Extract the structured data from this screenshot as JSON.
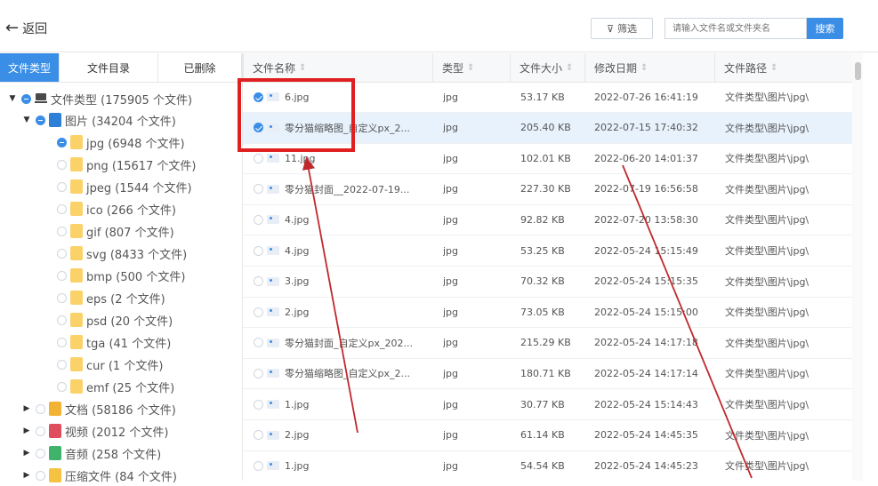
{
  "toolbar": {
    "back_label": "返回",
    "filter_label": "筛选",
    "search_placeholder": "请输入文件名或文件夹名",
    "search_button": "搜索"
  },
  "tabs": [
    {
      "label": "文件类型",
      "active": true
    },
    {
      "label": "文件目录",
      "active": false
    },
    {
      "label": "已删除",
      "active": false
    }
  ],
  "tree": [
    {
      "label": "文件类型 (175905 个文件)",
      "icon": "computer-icon",
      "expanded": true,
      "checked": true
    },
    {
      "label": "图片 (34204 个文件)",
      "icon": "image-folder-icon",
      "expanded": true,
      "checked": true
    },
    {
      "label": "jpg (6948 个文件)",
      "icon": "folder-icon",
      "checked": true
    },
    {
      "label": "png (15617 个文件)",
      "icon": "folder-icon",
      "checked": false
    },
    {
      "label": "jpeg (1544 个文件)",
      "icon": "folder-icon",
      "checked": false
    },
    {
      "label": "ico (266 个文件)",
      "icon": "folder-icon",
      "checked": false
    },
    {
      "label": "gif (807 个文件)",
      "icon": "folder-icon",
      "checked": false
    },
    {
      "label": "svg (8433 个文件)",
      "icon": "folder-icon",
      "checked": false
    },
    {
      "label": "bmp (500 个文件)",
      "icon": "folder-icon",
      "checked": false
    },
    {
      "label": "eps (2 个文件)",
      "icon": "folder-icon",
      "checked": false
    },
    {
      "label": "psd (20 个文件)",
      "icon": "folder-icon",
      "checked": false
    },
    {
      "label": "tga (41 个文件)",
      "icon": "folder-icon",
      "checked": false
    },
    {
      "label": "cur (1 个文件)",
      "icon": "folder-icon",
      "checked": false
    },
    {
      "label": "emf (25 个文件)",
      "icon": "folder-icon",
      "checked": false
    },
    {
      "label": "文档 (58186 个文件)",
      "icon": "document-folder-icon",
      "expanded": false,
      "checked": false
    },
    {
      "label": "视频 (2012 个文件)",
      "icon": "video-folder-icon",
      "expanded": false,
      "checked": false
    },
    {
      "label": "音频 (258 个文件)",
      "icon": "audio-folder-icon",
      "expanded": false,
      "checked": false
    },
    {
      "label": "压缩文件 (84 个文件)",
      "icon": "archive-folder-icon",
      "expanded": false,
      "checked": false
    }
  ],
  "columns": [
    "文件名称",
    "类型",
    "文件大小",
    "修改日期",
    "文件路径"
  ],
  "rows": [
    {
      "name": "6.jpg",
      "type": "jpg",
      "size": "53.17 KB",
      "date": "2022-07-26 16:41:19",
      "path": "文件类型\\图片\\jpg\\",
      "checked": true,
      "selected": false
    },
    {
      "name": "零分猫缩略图_自定义px_2...",
      "type": "jpg",
      "size": "205.40 KB",
      "date": "2022-07-15 17:40:32",
      "path": "文件类型\\图片\\jpg\\",
      "checked": true,
      "selected": true
    },
    {
      "name": "11.jpg",
      "type": "jpg",
      "size": "102.01 KB",
      "date": "2022-06-20 14:01:37",
      "path": "文件类型\\图片\\jpg\\",
      "checked": false,
      "selected": false
    },
    {
      "name": "零分猫封面__2022-07-19...",
      "type": "jpg",
      "size": "227.30 KB",
      "date": "2022-07-19 16:56:58",
      "path": "文件类型\\图片\\jpg\\",
      "checked": false,
      "selected": false
    },
    {
      "name": "4.jpg",
      "type": "jpg",
      "size": "92.82 KB",
      "date": "2022-07-20 13:58:30",
      "path": "文件类型\\图片\\jpg\\",
      "checked": false,
      "selected": false
    },
    {
      "name": "4.jpg",
      "type": "jpg",
      "size": "53.25 KB",
      "date": "2022-05-24 15:15:49",
      "path": "文件类型\\图片\\jpg\\",
      "checked": false,
      "selected": false
    },
    {
      "name": "3.jpg",
      "type": "jpg",
      "size": "70.32 KB",
      "date": "2022-05-24 15:15:35",
      "path": "文件类型\\图片\\jpg\\",
      "checked": false,
      "selected": false
    },
    {
      "name": "2.jpg",
      "type": "jpg",
      "size": "73.05 KB",
      "date": "2022-05-24 15:15:00",
      "path": "文件类型\\图片\\jpg\\",
      "checked": false,
      "selected": false
    },
    {
      "name": "零分猫封面_自定义px_202...",
      "type": "jpg",
      "size": "215.29 KB",
      "date": "2022-05-24 14:17:18",
      "path": "文件类型\\图片\\jpg\\",
      "checked": false,
      "selected": false
    },
    {
      "name": "零分猫缩略图_自定义px_2...",
      "type": "jpg",
      "size": "180.71 KB",
      "date": "2022-05-24 14:17:14",
      "path": "文件类型\\图片\\jpg\\",
      "checked": false,
      "selected": false
    },
    {
      "name": "1.jpg",
      "type": "jpg",
      "size": "30.77 KB",
      "date": "2022-05-24 15:14:43",
      "path": "文件类型\\图片\\jpg\\",
      "checked": false,
      "selected": false
    },
    {
      "name": "2.jpg",
      "type": "jpg",
      "size": "61.14 KB",
      "date": "2022-05-24 14:45:35",
      "path": "文件类型\\图片\\jpg\\",
      "checked": false,
      "selected": false
    },
    {
      "name": "1.jpg",
      "type": "jpg",
      "size": "54.54 KB",
      "date": "2022-05-24 14:45:23",
      "path": "文件类型\\图片\\jpg\\",
      "checked": false,
      "selected": false
    }
  ],
  "colors": {
    "accent": "#3a8ee6",
    "highlight": "#e02020",
    "selected_row": "#e8f2fd"
  }
}
